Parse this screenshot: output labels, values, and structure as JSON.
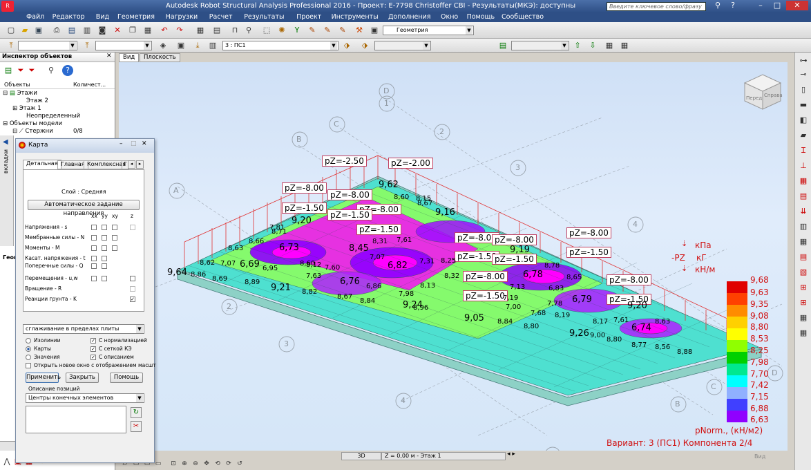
{
  "window": {
    "title": "Autodesk Robot Structural Analysis Professional 2016 - Проект: E-7798 Christoffer CBI - Результаты(МКЭ): доступны",
    "search_placeholder": "Введите ключевое слово/фразу"
  },
  "menu": [
    "Файл",
    "Редактор",
    "Вид",
    "Геометрия",
    "Нагрузки",
    "Расчет",
    "Результаты",
    "Проект",
    "Инструменты",
    "Дополнения",
    "Окно",
    "Помощь",
    "Сообщество"
  ],
  "toolbar": {
    "geometry_combo": "Геометрия",
    "case_combo": "3 : ПС1"
  },
  "view_tabs": [
    "Вид",
    "Плоскость"
  ],
  "inspector": {
    "title": "Инспектор объектов",
    "columns": [
      "Объекты",
      "Количест..."
    ],
    "items": [
      {
        "label": "Этажи",
        "count": ""
      },
      {
        "label": "Этаж 2",
        "count": ""
      },
      {
        "label": "Этаж 1",
        "count": ""
      },
      {
        "label": "Неопределенный",
        "count": ""
      },
      {
        "label": "Объекты модели",
        "count": ""
      },
      {
        "label": "Стержни",
        "count": "0/8"
      }
    ],
    "side_tab": "вкладки",
    "bottom_tab": "Геом"
  },
  "dialog": {
    "title": "Карта",
    "tabs": [
      "Детальная",
      "Главная",
      "Комплексная",
      "Г"
    ],
    "layer_label": "Слой : Средняя",
    "auto_dir_button": "Автоматическое задание направления",
    "col_headers": [
      "xx",
      "yy",
      "xy",
      "z"
    ],
    "rows": [
      {
        "label": "Напряжения - s",
        "checks": [
          false,
          false,
          false,
          false
        ]
      },
      {
        "label": "Мембранные силы - N",
        "checks": [
          false,
          false,
          false
        ]
      },
      {
        "label": "Моменты - M",
        "checks": [
          false,
          false,
          false
        ]
      },
      {
        "label": "Касат. напряжения - t",
        "checks": [
          false,
          false
        ]
      },
      {
        "label": "Поперечные силы - Q",
        "checks": [
          false,
          false
        ]
      },
      {
        "label": "Перемещения - u,w",
        "checks": [
          false,
          false,
          false
        ]
      },
      {
        "label": "Вращение - R",
        "checks": [
          false
        ]
      },
      {
        "label": "Реакции грунта - K",
        "checks": [
          true
        ]
      }
    ],
    "smoothing": "сглаживание в пределах плиты",
    "radio": [
      {
        "label": "Изолинии",
        "selected": false
      },
      {
        "label": "Карты",
        "selected": true
      },
      {
        "label": "Значения",
        "selected": false
      }
    ],
    "options": [
      {
        "label": "С нормализацией",
        "checked": true
      },
      {
        "label": "С сеткой КЭ",
        "checked": true
      },
      {
        "label": "С описанием",
        "checked": true
      }
    ],
    "open_new_window": "Открыть новое окно с отображением масшт",
    "buttons": {
      "apply": "Применить",
      "close": "Закрыть",
      "help": "Помощь"
    },
    "pos_desc_label": "Описание позиций",
    "pos_desc_value": "Центры конечных элементов"
  },
  "units": {
    "kpa": "кПа",
    "pz": "-PZ",
    "kg": "кГ",
    "kn_m": "кН/м"
  },
  "legend": {
    "values": [
      "9,68",
      "9,63",
      "9,35",
      "9,08",
      "8,80",
      "8,53",
      "8,25",
      "7,98",
      "7,70",
      "7,42",
      "7,15",
      "6,88",
      "6,63"
    ],
    "colors": [
      "#e00000",
      "#ff4000",
      "#ff8c00",
      "#ffd000",
      "#ffff00",
      "#90ff00",
      "#00d000",
      "#00e890",
      "#00ffff",
      "#90b0ff",
      "#4040ff",
      "#9000ff",
      "#ff00ff"
    ],
    "unit": "pNorm., (кН/м2)",
    "variant": "Вариант: 3 (ПС1) Компонента 2/4"
  },
  "loads": [
    "pZ=-2.50",
    "pZ=-2.00",
    "pZ=-8.00",
    "pZ=-8.00",
    "pZ=-8.00",
    "pZ=-1.50",
    "pZ=-1.50",
    "pZ=-1.50",
    "pZ=-8.00",
    "pZ=-8.00",
    "pZ=-1.50",
    "pZ=-1.50",
    "pZ=-8.00",
    "pZ=-1.50",
    "pZ=-8.00",
    "pZ=-1.50",
    "pZ=-8.00",
    "pZ=-1.50"
  ],
  "axes": [
    "D",
    "1",
    "C",
    "2",
    "B",
    "3",
    "A",
    "4",
    "2",
    "3",
    "4",
    "B",
    "C",
    "D",
    "1",
    "2",
    "1",
    "A",
    "A"
  ],
  "values_big": [
    "9,62",
    "9,20",
    "8,45",
    "9,16",
    "6,73",
    "6,69",
    "6,82",
    "6,76",
    "9,19",
    "6,78",
    "6,79",
    "9,64",
    "9,21",
    "9,24",
    "9,05",
    "9,26",
    "6,74",
    "9,20"
  ],
  "values_small": [
    "8,60",
    "8,67",
    "8,71",
    "8,63",
    "8,66",
    "8,62",
    "7,07",
    "6,95",
    "8,89",
    "8,86",
    "8,69",
    "8,82",
    "8,67",
    "8,84",
    "8,96",
    "8,84",
    "8,80",
    "8,80",
    "8,77",
    "8,56",
    "8,88",
    "9,00",
    "8,17",
    "7,61",
    "8,63",
    "8,65",
    "8,78",
    "8,60",
    "8,25",
    "7,60",
    "7,31",
    "7,07",
    "6,86",
    "7,13",
    "6,83",
    "7,19",
    "7,78",
    "8,19",
    "7,00",
    "7,68",
    "8,13",
    "8,32",
    "8,15",
    "7,61",
    "8,31",
    "8,12",
    "7,63",
    "7,98",
    "7,81"
  ],
  "viewcube": {
    "left": "Перед",
    "right": "Справа"
  },
  "status": {
    "mode": "3D",
    "z": "Z = 0,00 м - Этаж 1",
    "view_label": "Вид"
  }
}
